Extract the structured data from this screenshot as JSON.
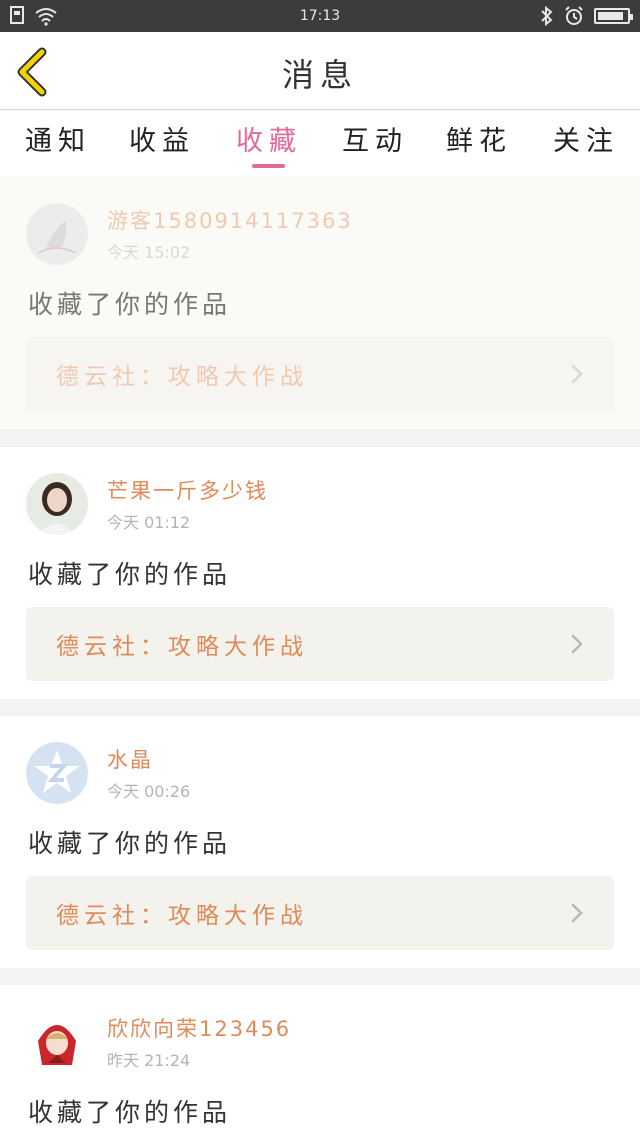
{
  "status_bar": {
    "time": "17:13",
    "left_icons": [
      "sim-icon",
      "wifi-icon"
    ],
    "right_icons": [
      "bluetooth-icon",
      "alarm-icon",
      "battery-icon"
    ],
    "battery_level": 0.9
  },
  "header": {
    "title": "消息",
    "back_icon": "chevron-left-icon"
  },
  "tabs": [
    {
      "label": "通知",
      "active": false
    },
    {
      "label": "收益",
      "active": false
    },
    {
      "label": "收藏",
      "active": true
    },
    {
      "label": "互动",
      "active": false
    },
    {
      "label": "鲜花",
      "active": false
    },
    {
      "label": "关注",
      "active": false
    }
  ],
  "messages": [
    {
      "username": "游客1580914117363",
      "time": "今天 15:02",
      "action": "收藏了你的作品",
      "work": "德云社：攻略大作战"
    },
    {
      "username": "芒果一斤多少钱",
      "time": "今天 01:12",
      "action": "收藏了你的作品",
      "work": "德云社：攻略大作战"
    },
    {
      "username": "水晶",
      "time": "今天 00:26",
      "action": "收藏了你的作品",
      "work": "德云社：攻略大作战"
    },
    {
      "username": "欣欣向荣123456",
      "time": "昨天 21:24",
      "action": "收藏了你的作品",
      "work": ""
    }
  ],
  "colors": {
    "accent": "#e26a9a",
    "username": "#e08a5a",
    "back_arrow": "#f2d400"
  }
}
